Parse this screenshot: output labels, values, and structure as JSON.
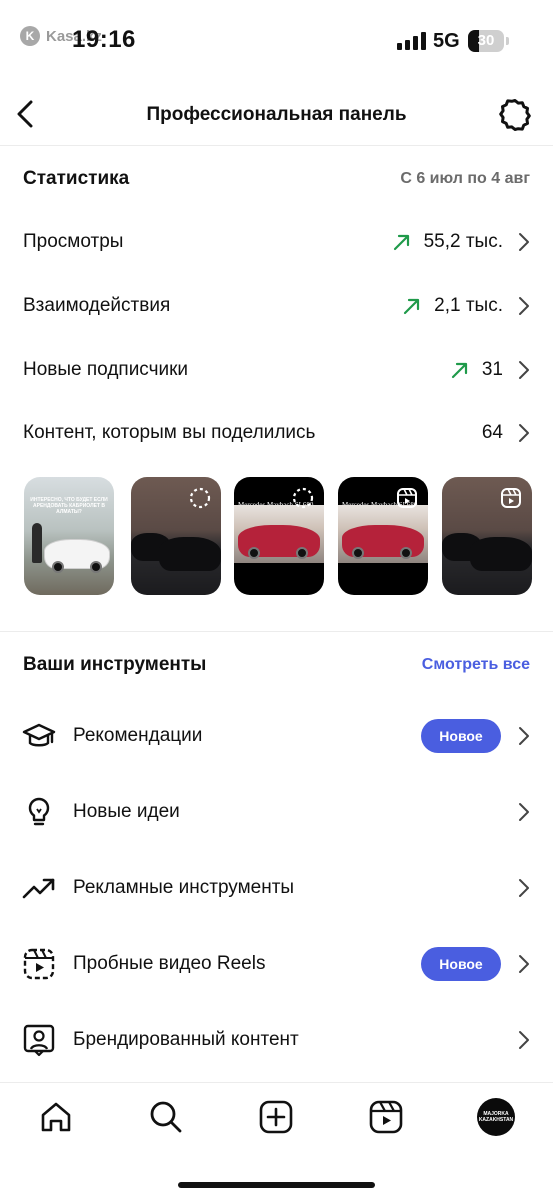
{
  "status_bar": {
    "watermark": "Kasa.kz",
    "time": "19:16",
    "network": "5G",
    "battery_percent": "30",
    "battery_level": 0.3
  },
  "header": {
    "title": "Профессиональная панель",
    "back_icon": "chevron-left-icon",
    "settings_icon": "gear-icon"
  },
  "statistics": {
    "title": "Статистика",
    "date_range": "С 6 июл по 4 авг",
    "rows": [
      {
        "label": "Просмотры",
        "value": "55,2 тыс.",
        "trend": "up"
      },
      {
        "label": "Взаимодействия",
        "value": "2,1 тыс.",
        "trend": "up"
      },
      {
        "label": "Новые подписчики",
        "value": "31",
        "trend": "up"
      },
      {
        "label": "Контент, которым вы поделились",
        "value": "64",
        "trend": ""
      }
    ],
    "thumbnails": [
      {
        "caption": "ИНТЕРЕСНО, ЧТО БУДЕТ ЕСЛИ АРЕНДОВАТЬ КАБРИОЛЕТ В АЛМАТЫ?",
        "badge": "none"
      },
      {
        "caption": "",
        "badge": "loading-icon"
      },
      {
        "caption": "Mercedes Maybach SL680",
        "badge": "loading-icon"
      },
      {
        "caption": "Mercedes Maybach SL680",
        "badge": "reels-icon"
      },
      {
        "caption": "",
        "badge": "reels-icon"
      }
    ]
  },
  "tools": {
    "title": "Ваши инструменты",
    "see_all": "Смотреть все",
    "items": [
      {
        "label": "Рекомендации",
        "icon": "graduation-cap-icon",
        "badge": "Новое"
      },
      {
        "label": "Новые идеи",
        "icon": "lightbulb-icon",
        "badge": ""
      },
      {
        "label": "Рекламные инструменты",
        "icon": "trending-up-icon",
        "badge": ""
      },
      {
        "label": "Пробные видео Reels",
        "icon": "reels-trial-icon",
        "badge": "Новое"
      },
      {
        "label": "Брендированный контент",
        "icon": "branded-content-icon",
        "badge": ""
      }
    ]
  },
  "bottom_nav": {
    "items": [
      "home-icon",
      "search-icon",
      "create-icon",
      "reels-icon",
      "profile-avatar"
    ],
    "avatar_text": "MAJORKA KAZAKHSTAN"
  },
  "colors": {
    "accent": "#4a5ee0",
    "trend_up": "#1f9a4a",
    "secondary_text": "#6b6b6b"
  }
}
